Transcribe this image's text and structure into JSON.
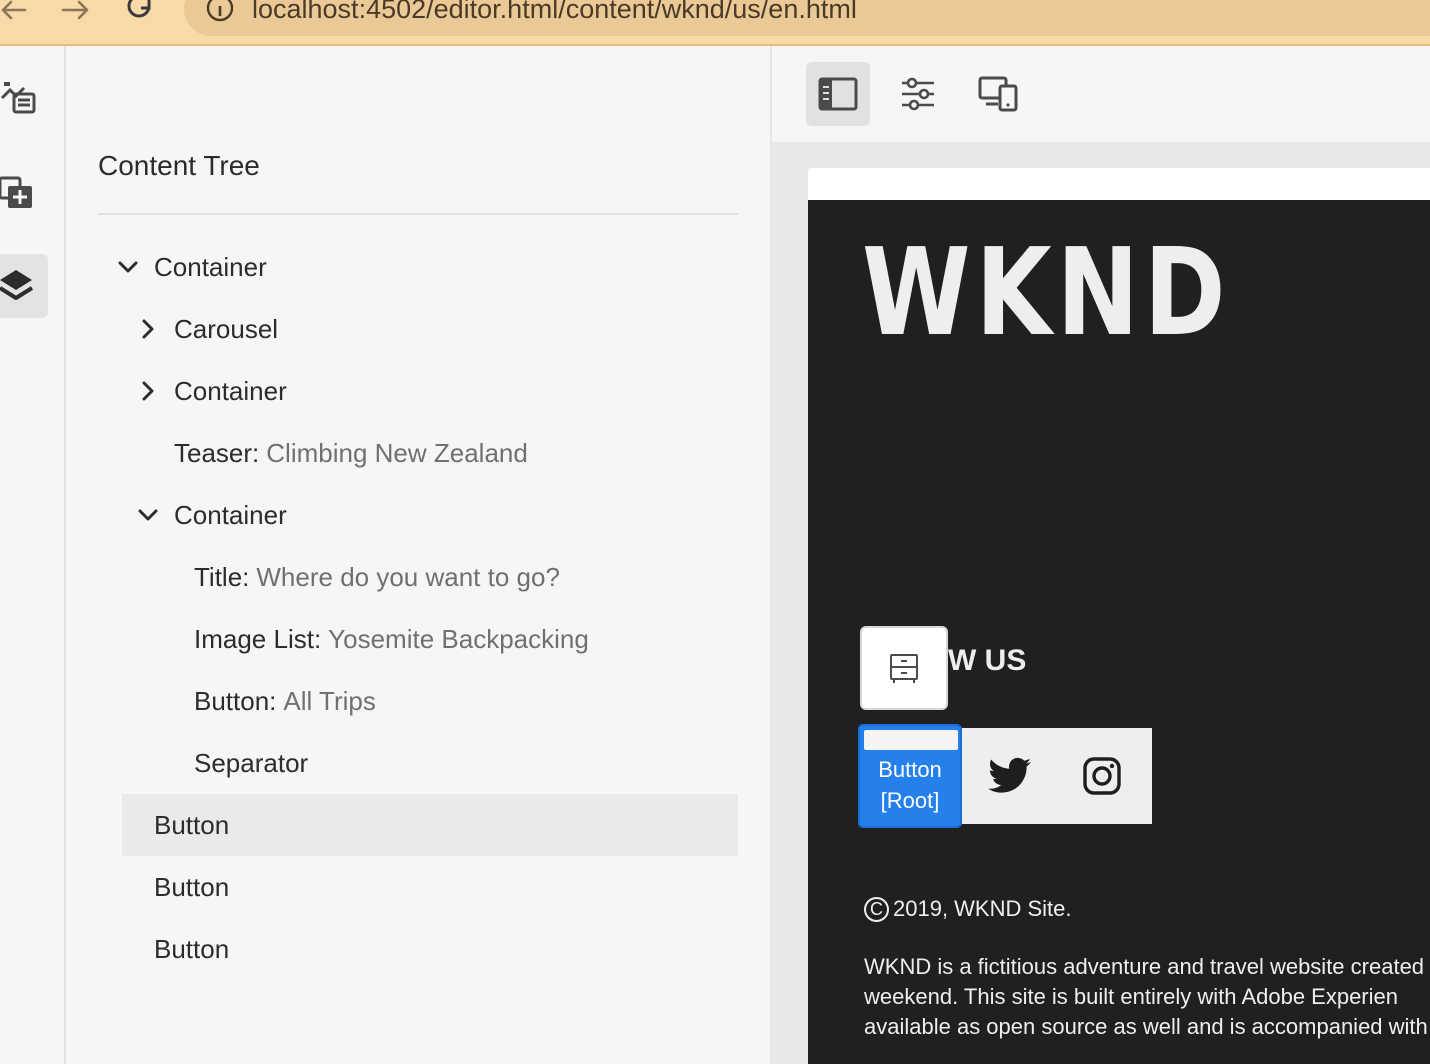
{
  "browser": {
    "url": "localhost:4502/editor.html/content/wknd/us/en.html"
  },
  "rail": {
    "items": [
      {
        "name": "assets-icon",
        "active": false
      },
      {
        "name": "components-icon",
        "active": false
      },
      {
        "name": "layers-icon",
        "active": true
      }
    ]
  },
  "tree": {
    "title": "Content Tree",
    "rows": [
      {
        "label": "Container",
        "value": "",
        "depth": 0,
        "chevron": "down"
      },
      {
        "label": "Carousel",
        "value": "",
        "depth": 1,
        "chevron": "right"
      },
      {
        "label": "Container",
        "value": "",
        "depth": 1,
        "chevron": "right"
      },
      {
        "label": "Teaser:",
        "value": "Climbing New Zealand",
        "depth": 1,
        "chevron": "none"
      },
      {
        "label": "Container",
        "value": "",
        "depth": 1,
        "chevron": "down"
      },
      {
        "label": "Title:",
        "value": "Where do you want to go?",
        "depth": 2,
        "chevron": "none"
      },
      {
        "label": "Image List:",
        "value": "Yosemite Backpacking",
        "depth": 2,
        "chevron": "none"
      },
      {
        "label": "Button:",
        "value": "All Trips",
        "depth": 2,
        "chevron": "none"
      },
      {
        "label": "Separator",
        "value": "",
        "depth": 2,
        "chevron": "none"
      },
      {
        "label": "Button",
        "value": "",
        "depth": 0,
        "chevron": "none",
        "selected": true
      },
      {
        "label": "Button",
        "value": "",
        "depth": 0,
        "chevron": "none"
      },
      {
        "label": "Button",
        "value": "",
        "depth": 0,
        "chevron": "none"
      }
    ]
  },
  "toolbar": {
    "buttons": [
      "side-panel-icon",
      "properties-icon",
      "emulator-icon"
    ]
  },
  "site": {
    "logo": "WKND",
    "follow_heading": "W US",
    "overlay_label_line1": "Button",
    "overlay_label_line2": "[Root]",
    "copyright_mark": "C",
    "copyright_text": "2019,  WKND Site.",
    "about_lines": [
      "WKND is a fictitious adventure and travel website created",
      "weekend. This site is built entirely with Adobe Experien",
      "available as open source as well and is accompanied with"
    ]
  }
}
